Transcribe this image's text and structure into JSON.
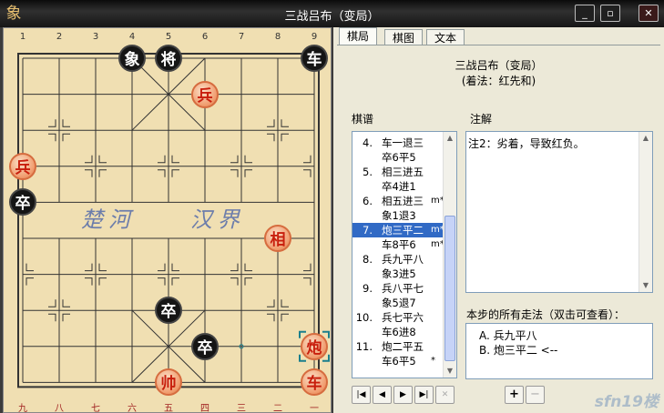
{
  "window": {
    "title": "三战吕布（变局）",
    "app_icon": "象",
    "buttons": [
      "_",
      "▫",
      "✕"
    ]
  },
  "board": {
    "top_numbers": [
      "1",
      "2",
      "3",
      "4",
      "5",
      "6",
      "7",
      "8",
      "9"
    ],
    "bottom_numbers": [
      "九",
      "八",
      "七",
      "六",
      "五",
      "四",
      "三",
      "二",
      "一"
    ],
    "river": [
      "楚河",
      "汉界"
    ],
    "pieces": [
      {
        "name": "black-elephant",
        "label": "象",
        "side": "b",
        "file": 3,
        "rank": 0
      },
      {
        "name": "black-general",
        "label": "将",
        "side": "b",
        "file": 4,
        "rank": 0
      },
      {
        "name": "black-chariot",
        "label": "车",
        "side": "b",
        "file": 8,
        "rank": 0
      },
      {
        "name": "red-soldier-1",
        "label": "兵",
        "side": "r",
        "file": 5,
        "rank": 1
      },
      {
        "name": "red-soldier-2",
        "label": "兵",
        "side": "r",
        "file": 0,
        "rank": 3
      },
      {
        "name": "black-soldier-1",
        "label": "卒",
        "side": "b",
        "file": 0,
        "rank": 4
      },
      {
        "name": "red-minister",
        "label": "相",
        "side": "r",
        "file": 7,
        "rank": 5
      },
      {
        "name": "black-soldier-2",
        "label": "卒",
        "side": "b",
        "file": 4,
        "rank": 7
      },
      {
        "name": "black-soldier-3",
        "label": "卒",
        "side": "b",
        "file": 5,
        "rank": 8
      },
      {
        "name": "red-cannon",
        "label": "炮",
        "side": "r",
        "file": 8,
        "rank": 8
      },
      {
        "name": "red-king",
        "label": "帅",
        "side": "r",
        "file": 4,
        "rank": 9
      },
      {
        "name": "red-chariot",
        "label": "车",
        "side": "r",
        "file": 9,
        "rank": 9
      }
    ]
  },
  "tabs": [
    "棋局",
    "棋图",
    "文本"
  ],
  "game": {
    "title": "三战吕布（变局）",
    "subtitle": "(着法：红先和)"
  },
  "labels": {
    "record": "棋谱",
    "notes": "注解",
    "alternatives": "本步的所有走法（双击可查看）："
  },
  "moves": [
    {
      "num": "4.",
      "text": "车一退三",
      "flag": "",
      "selected": false
    },
    {
      "num": "",
      "text": "卒6平5",
      "flag": "",
      "selected": false
    },
    {
      "num": "5.",
      "text": "相三进五",
      "flag": "",
      "selected": false
    },
    {
      "num": "",
      "text": "卒4进1",
      "flag": "",
      "selected": false
    },
    {
      "num": "6.",
      "text": "相五进三",
      "flag": "m*",
      "selected": false
    },
    {
      "num": "",
      "text": "象1退3",
      "flag": "",
      "selected": false
    },
    {
      "num": "7.",
      "text": "炮三平二",
      "flag": "m*",
      "selected": true
    },
    {
      "num": "",
      "text": "车8平6",
      "flag": "m*",
      "selected": false
    },
    {
      "num": "8.",
      "text": "兵九平八",
      "flag": "",
      "selected": false
    },
    {
      "num": "",
      "text": "象3进5",
      "flag": "",
      "selected": false
    },
    {
      "num": "9.",
      "text": "兵八平七",
      "flag": "",
      "selected": false
    },
    {
      "num": "",
      "text": "象5退7",
      "flag": "",
      "selected": false
    },
    {
      "num": "10.",
      "text": "兵七平六",
      "flag": "",
      "selected": false
    },
    {
      "num": "",
      "text": "车6进8",
      "flag": "",
      "selected": false
    },
    {
      "num": "11.",
      "text": "炮二平五",
      "flag": "",
      "selected": false
    },
    {
      "num": "",
      "text": "车6平5",
      "flag": "*",
      "selected": false
    }
  ],
  "note_text": "注2：劣着，导致红负。",
  "alternatives": [
    "A. 兵九平八",
    "B. 炮三平二 <--"
  ],
  "nav_buttons": [
    "|◀",
    "◀",
    "▶",
    "▶|",
    "✕"
  ],
  "edit_buttons": [
    "+",
    "−"
  ],
  "watermark": "sfn19楼"
}
